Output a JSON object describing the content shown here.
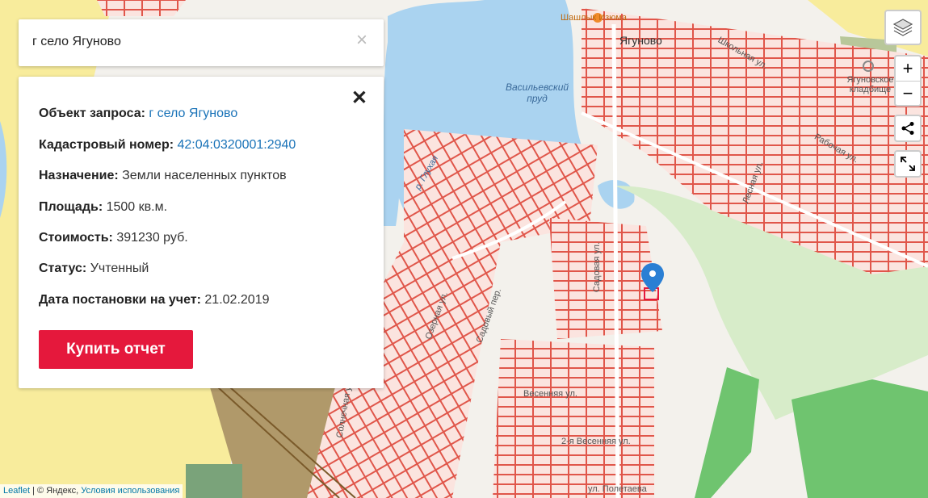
{
  "search": {
    "query": "г село Ягуново",
    "clear_icon": "×"
  },
  "card": {
    "close_icon": "✕",
    "object_label": "Объект запроса:",
    "object_value": "г село Ягуново",
    "cadastral_label": "Кадастровый номер:",
    "cadastral_value": "42:04:0320001:2940",
    "purpose_label": "Назначение:",
    "purpose_value": "Земли населенных пунктов",
    "area_label": "Площадь:",
    "area_value": "1500 кв.м.",
    "cost_label": "Стоимость:",
    "cost_value": "391230 руб.",
    "status_label": "Статус:",
    "status_value": "Учтенный",
    "date_label": "Дата постановки на учет:",
    "date_value": "21.02.2019",
    "buy_button": "Купить отчет"
  },
  "map_labels": {
    "village": "Ягуново",
    "pond": "Васильевский пруд",
    "cafe": "Шашлык Изюма",
    "cemetery": "Ягуновское кладбище",
    "river": "р. Глухая",
    "street_shkolnaya": "Школьная ул.",
    "street_rabochaya": "Рабочая ул.",
    "street_lesnaya": "Лесная ул.",
    "street_sadovaya": "Садовая ул.",
    "street_sadoviy": "Садовый пер.",
    "street_ozernaya": "Озерная ул.",
    "street_vesennyaya": "Весенняя ул.",
    "street_vesennyaya2": "2-я Весенняя ул.",
    "street_poletaeva": "ул. Полетаева",
    "street_solnechnaya": "Солнечная ул."
  },
  "controls": {
    "layers_icon": "layers-icon",
    "zoom_in": "+",
    "zoom_out": "−",
    "share_icon": "share-icon",
    "fullscreen_icon": "fullscreen-icon"
  },
  "attribution": {
    "leaflet": "Leaflet",
    "sep": " | © Яндекс, ",
    "terms": "Условия использования"
  },
  "colors": {
    "accent": "#e5183c",
    "link": "#1a73b8",
    "parcel": "#e0564a",
    "water": "#aad3f0",
    "forest": "#6fc46f"
  }
}
